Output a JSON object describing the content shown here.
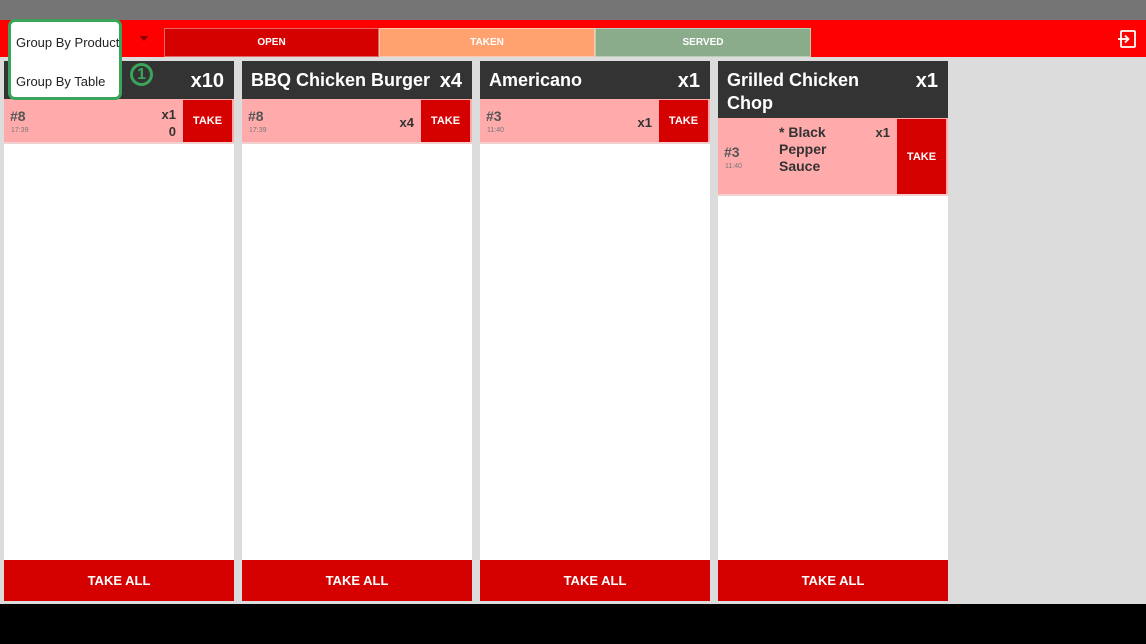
{
  "group_menu": {
    "items": [
      "Group By Product",
      "Group By Table"
    ]
  },
  "tabs": [
    {
      "label": "OPEN"
    },
    {
      "label": "TAKEN"
    },
    {
      "label": "SERVED"
    }
  ],
  "annotation_marker": "1",
  "columns": [
    {
      "title": "",
      "qty": "x10",
      "take_all": "TAKE ALL",
      "orders": [
        {
          "table": "#8",
          "time": "17:39",
          "qty": "x1\n0",
          "take": "TAKE"
        }
      ]
    },
    {
      "title": "BBQ Chicken Burger",
      "qty": "x4",
      "take_all": "TAKE ALL",
      "orders": [
        {
          "table": "#8",
          "time": "17:39",
          "qty": "x4",
          "take": "TAKE"
        }
      ]
    },
    {
      "title": "Americano",
      "qty": "x1",
      "take_all": "TAKE ALL",
      "orders": [
        {
          "table": "#3",
          "time": "11:40",
          "qty": "x1",
          "take": "TAKE"
        }
      ]
    },
    {
      "title": "Grilled Chicken Chop",
      "qty": "x1",
      "take_all": "TAKE ALL",
      "orders": [
        {
          "table": "#3",
          "time": "11:40",
          "modifier": "* Black Pepper Sauce",
          "qty": "x1",
          "take": "TAKE"
        }
      ]
    }
  ],
  "colors": {
    "brand_red": "#ff0000",
    "button_red": "#d50000",
    "taken": "#ffa270",
    "served": "#8aac8a",
    "order_bg": "#ffabab",
    "highlight": "#3aa55a"
  },
  "icons": {
    "logout": "logout-icon",
    "dropdown": "chevron-down-icon"
  }
}
